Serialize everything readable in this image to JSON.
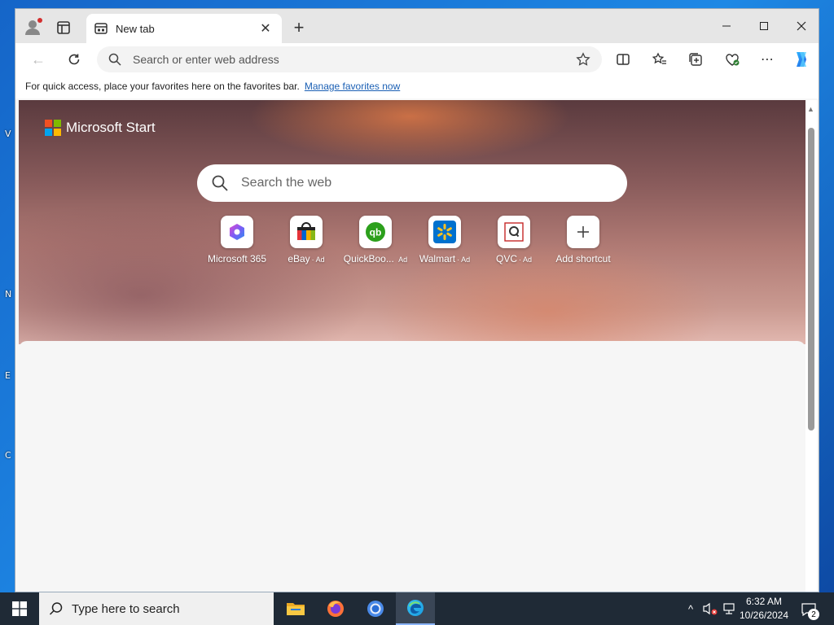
{
  "desktop": {
    "edge_labels": [
      "V",
      "N",
      "E",
      "C"
    ]
  },
  "browser": {
    "tab": {
      "title": "New tab"
    },
    "address_bar": {
      "placeholder": "Search or enter web address",
      "value": ""
    },
    "favorites_bar": {
      "message": "For quick access, place your favorites here on the favorites bar.",
      "link_label": "Manage favorites now"
    }
  },
  "start_page": {
    "brand": "Microsoft Start",
    "search_placeholder": "Search the web",
    "shortcuts": [
      {
        "label": "Microsoft 365",
        "ad": ""
      },
      {
        "label": "eBay",
        "ad": "· Ad"
      },
      {
        "label": "QuickBoo...",
        "ad": "Ad"
      },
      {
        "label": "Walmart",
        "ad": "· Ad"
      },
      {
        "label": "QVC",
        "ad": "· Ad"
      },
      {
        "label": "Add shortcut",
        "ad": ""
      }
    ]
  },
  "taskbar": {
    "search_placeholder": "Type here to search",
    "clock": {
      "time": "6:32 AM",
      "date": "10/26/2024"
    },
    "notification_count": "2"
  },
  "colors": {
    "accent": "#0078d4",
    "taskbar": "#1f2a36",
    "link": "#1a5fb4"
  }
}
